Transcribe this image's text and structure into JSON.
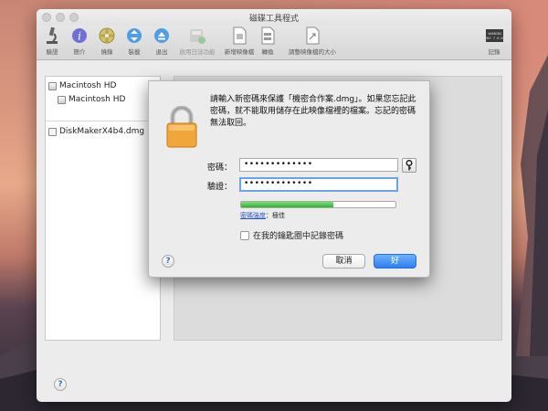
{
  "window": {
    "title": "磁碟工具程式"
  },
  "toolbar": {
    "items": [
      {
        "label": "驗證",
        "icon": "microscope-icon"
      },
      {
        "label": "簡介",
        "icon": "info-icon"
      },
      {
        "label": "燒錄",
        "icon": "burn-icon"
      },
      {
        "label": "裝載",
        "icon": "mount-icon"
      },
      {
        "label": "退出",
        "icon": "eject-icon"
      },
      {
        "label": "啟用日誌功能",
        "icon": "journal-icon"
      },
      {
        "label": "新增映像檔",
        "icon": "new-image-icon"
      },
      {
        "label": "轉換",
        "icon": "convert-icon"
      },
      {
        "label": "調整映像檔的大小",
        "icon": "resize-image-icon"
      },
      {
        "label": "記錄",
        "icon": "log-icon"
      }
    ],
    "log_icon_text": "WARNING\nMAY 7 0:36"
  },
  "sidebar": {
    "items": [
      {
        "label": "Macintosh HD"
      },
      {
        "label": "Macintosh HD"
      },
      {
        "label": "DiskMakerX4b4.dmg"
      }
    ]
  },
  "sheet": {
    "message": "請輸入新密碼來保護「機密合作案.dmg」。如果您忘記此密碼，就不能取用儲存在此映像檔裡的檔案。忘記的密碼無法取回。",
    "password_label": "密碼：",
    "password_value": "•••••••••••••",
    "verify_label": "驗證：",
    "verify_value": "•••••••••••••",
    "strength_fraction": 0.6,
    "strength_link": "密碼強度",
    "strength_value": "：極佳",
    "remember_label": "在我的鑰匙圈中記錄密碼",
    "cancel_label": "取消",
    "ok_label": "好"
  },
  "help_label": "?",
  "colors": {
    "accent": "#2d7ef0",
    "strength": "#2fb32f"
  }
}
